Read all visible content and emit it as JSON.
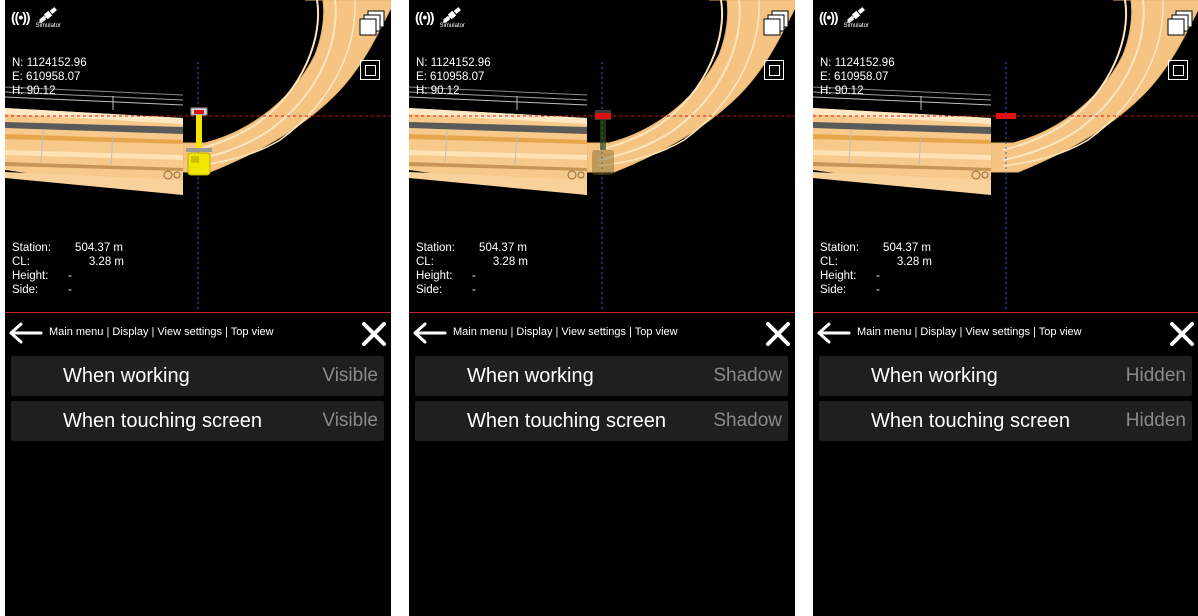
{
  "panels": [
    {
      "status": {
        "radio_icon": "((•))",
        "gps_label": "Simulator"
      },
      "coords": {
        "n": "N: 1124152.96",
        "e": "E: 610958.07",
        "h": "H: 90.12"
      },
      "readout": [
        {
          "key": "Station:",
          "value": "504.37 m"
        },
        {
          "key": "CL:",
          "value": "3.28 m"
        },
        {
          "key": "Height:",
          "value": "-"
        },
        {
          "key": "Side:",
          "value": "-"
        }
      ],
      "breadcrumb": "Main menu | Display | View settings | Top view",
      "settings": [
        {
          "label": "When working",
          "value": "Visible"
        },
        {
          "label": "When touching screen",
          "value": "Visible"
        }
      ],
      "machine_display": "visible"
    },
    {
      "status": {
        "radio_icon": "((•))",
        "gps_label": "Simulator"
      },
      "coords": {
        "n": "N: 1124152.96",
        "e": "E: 610958.07",
        "h": "H: 90.12"
      },
      "readout": [
        {
          "key": "Station:",
          "value": "504.37 m"
        },
        {
          "key": "CL:",
          "value": "3.28 m"
        },
        {
          "key": "Height:",
          "value": "-"
        },
        {
          "key": "Side:",
          "value": "-"
        }
      ],
      "breadcrumb": "Main menu | Display | View settings | Top view",
      "settings": [
        {
          "label": "When working",
          "value": "Shadow"
        },
        {
          "label": "When touching screen",
          "value": "Shadow"
        }
      ],
      "machine_display": "shadow"
    },
    {
      "status": {
        "radio_icon": "((•))",
        "gps_label": "Simulator"
      },
      "coords": {
        "n": "N: 1124152.96",
        "e": "E: 610958.07",
        "h": "H: 90.12"
      },
      "readout": [
        {
          "key": "Station:",
          "value": "504.37 m"
        },
        {
          "key": "CL:",
          "value": "3.28 m"
        },
        {
          "key": "Height:",
          "value": "-"
        },
        {
          "key": "Side:",
          "value": "-"
        }
      ],
      "breadcrumb": "Main menu | Display | View settings | Top view",
      "settings": [
        {
          "label": "When working",
          "value": "Hidden"
        },
        {
          "label": "When touching screen",
          "value": "Hidden"
        }
      ],
      "machine_display": "hidden"
    }
  ],
  "colors": {
    "road": "#f7c98a",
    "road_light": "#fbe0b3",
    "divider": "#c8262a",
    "machine_yellow": "#f2e600",
    "marker_red": "#e01010"
  }
}
